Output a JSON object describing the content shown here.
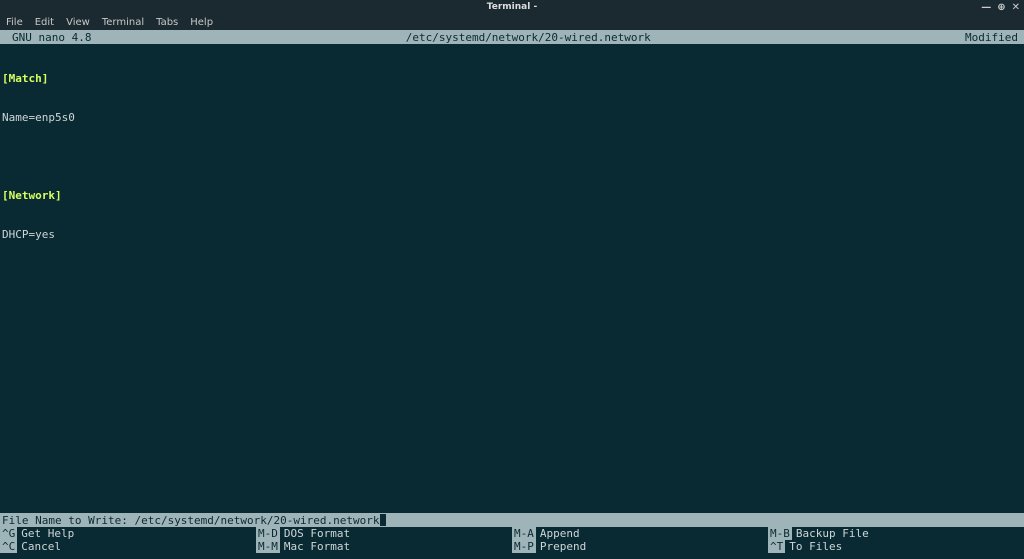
{
  "titlebar": {
    "title": "Terminal -",
    "controls": {
      "minimize": "—",
      "maximize": "⊕",
      "close": "✕"
    }
  },
  "menubar": {
    "items": [
      "File",
      "Edit",
      "View",
      "Terminal",
      "Tabs",
      "Help"
    ]
  },
  "nano_header": {
    "left": "GNU nano 4.8",
    "center": "/etc/systemd/network/20-wired.network",
    "right": "Modified"
  },
  "editor": {
    "lines": [
      {
        "text": "[Match]",
        "section": true
      },
      {
        "text": "Name=enp5s0",
        "section": false
      },
      {
        "text": "",
        "section": false
      },
      {
        "text": "[Network]",
        "section": true
      },
      {
        "text": "DHCP=yes",
        "section": false
      }
    ]
  },
  "prompt": {
    "label": "File Name to Write: ",
    "value": "/etc/systemd/network/20-wired.network"
  },
  "shortcuts": [
    [
      {
        "key": "^G",
        "label": "Get Help"
      },
      {
        "key": "M-D",
        "label": "DOS Format"
      },
      {
        "key": "M-A",
        "label": "Append"
      },
      {
        "key": "M-B",
        "label": "Backup File"
      }
    ],
    [
      {
        "key": "^C",
        "label": "Cancel"
      },
      {
        "key": "M-M",
        "label": "Mac Format"
      },
      {
        "key": "M-P",
        "label": "Prepend"
      },
      {
        "key": "^T",
        "label": "To Files"
      }
    ]
  ]
}
